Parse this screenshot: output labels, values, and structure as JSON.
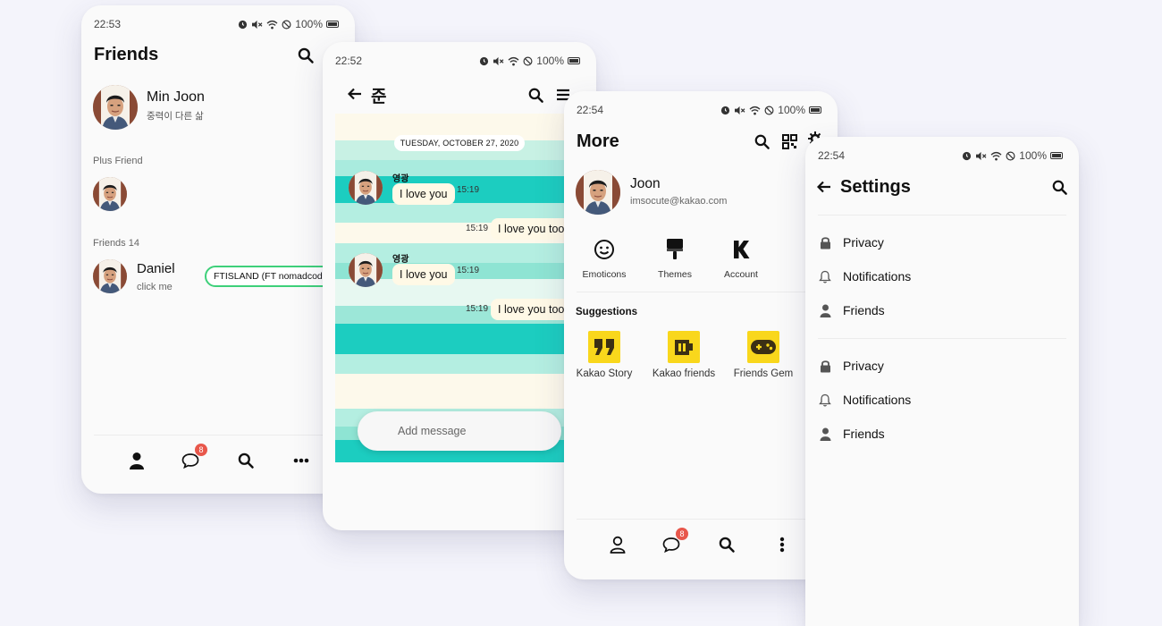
{
  "friends_screen": {
    "time": "22:53",
    "battery": "100%",
    "title": "Friends",
    "me": {
      "name": "Min Joon",
      "status": "중력이 다른 삶"
    },
    "plus_friend_label": "Plus Friend",
    "friends_count_label": "Friends 14",
    "friend": {
      "name": "Daniel",
      "status": "click me",
      "music_chip": "FTISLAND (FT nomadcoder)"
    },
    "nav": {
      "chats_badge": "8"
    }
  },
  "chat_screen": {
    "time": "22:52",
    "battery": "100%",
    "title": "준",
    "date": "TUESDAY, OCTOBER 27, 2020",
    "messages": [
      {
        "sender": "영광",
        "text": "I love you",
        "time": "15:19",
        "side": "left"
      },
      {
        "text": "I love you too",
        "time": "15:19",
        "side": "right"
      },
      {
        "sender": "영광",
        "text": "I love you",
        "time": "15:19",
        "side": "left"
      },
      {
        "text": "I love you too",
        "time": "15:19",
        "side": "right"
      }
    ],
    "input_placeholder": "Add message"
  },
  "more_screen": {
    "time": "22:54",
    "battery": "100%",
    "title": "More",
    "profile": {
      "name": "Joon",
      "email": "imsocute@kakao.com"
    },
    "grid": [
      "Emoticons",
      "Themes",
      "Account"
    ],
    "suggestions_label": "Suggestions",
    "suggestions": [
      "Kakao Story",
      "Kakao friends",
      "Friends Gem"
    ],
    "nav": {
      "chats_badge": "8"
    }
  },
  "settings_screen": {
    "time": "22:54",
    "battery": "100%",
    "title": "Settings",
    "group1": [
      "Privacy",
      "Notifications",
      "Friends"
    ],
    "group2": [
      "Privacy",
      "Notifications",
      "Friends"
    ]
  },
  "colors": {
    "accent_yellow": "#f9d71c",
    "badge_red": "#e8574b",
    "chat_teal": "#1ccdc0",
    "chip_green": "#3ed07a"
  }
}
